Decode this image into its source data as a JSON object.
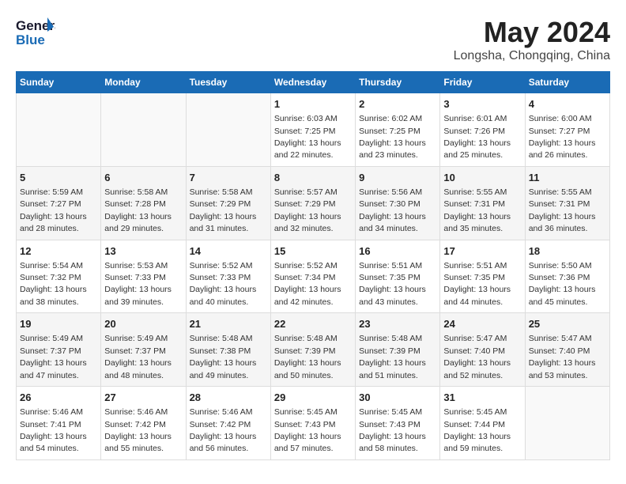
{
  "header": {
    "logo_line1": "General",
    "logo_line2": "Blue",
    "title": "May 2024",
    "subtitle": "Longsha, Chongqing, China"
  },
  "weekdays": [
    "Sunday",
    "Monday",
    "Tuesday",
    "Wednesday",
    "Thursday",
    "Friday",
    "Saturday"
  ],
  "weeks": [
    {
      "days": [
        {
          "num": "",
          "info": ""
        },
        {
          "num": "",
          "info": ""
        },
        {
          "num": "",
          "info": ""
        },
        {
          "num": "1",
          "info": "Sunrise: 6:03 AM\nSunset: 7:25 PM\nDaylight: 13 hours\nand 22 minutes."
        },
        {
          "num": "2",
          "info": "Sunrise: 6:02 AM\nSunset: 7:25 PM\nDaylight: 13 hours\nand 23 minutes."
        },
        {
          "num": "3",
          "info": "Sunrise: 6:01 AM\nSunset: 7:26 PM\nDaylight: 13 hours\nand 25 minutes."
        },
        {
          "num": "4",
          "info": "Sunrise: 6:00 AM\nSunset: 7:27 PM\nDaylight: 13 hours\nand 26 minutes."
        }
      ]
    },
    {
      "days": [
        {
          "num": "5",
          "info": "Sunrise: 5:59 AM\nSunset: 7:27 PM\nDaylight: 13 hours\nand 28 minutes."
        },
        {
          "num": "6",
          "info": "Sunrise: 5:58 AM\nSunset: 7:28 PM\nDaylight: 13 hours\nand 29 minutes."
        },
        {
          "num": "7",
          "info": "Sunrise: 5:58 AM\nSunset: 7:29 PM\nDaylight: 13 hours\nand 31 minutes."
        },
        {
          "num": "8",
          "info": "Sunrise: 5:57 AM\nSunset: 7:29 PM\nDaylight: 13 hours\nand 32 minutes."
        },
        {
          "num": "9",
          "info": "Sunrise: 5:56 AM\nSunset: 7:30 PM\nDaylight: 13 hours\nand 34 minutes."
        },
        {
          "num": "10",
          "info": "Sunrise: 5:55 AM\nSunset: 7:31 PM\nDaylight: 13 hours\nand 35 minutes."
        },
        {
          "num": "11",
          "info": "Sunrise: 5:55 AM\nSunset: 7:31 PM\nDaylight: 13 hours\nand 36 minutes."
        }
      ]
    },
    {
      "days": [
        {
          "num": "12",
          "info": "Sunrise: 5:54 AM\nSunset: 7:32 PM\nDaylight: 13 hours\nand 38 minutes."
        },
        {
          "num": "13",
          "info": "Sunrise: 5:53 AM\nSunset: 7:33 PM\nDaylight: 13 hours\nand 39 minutes."
        },
        {
          "num": "14",
          "info": "Sunrise: 5:52 AM\nSunset: 7:33 PM\nDaylight: 13 hours\nand 40 minutes."
        },
        {
          "num": "15",
          "info": "Sunrise: 5:52 AM\nSunset: 7:34 PM\nDaylight: 13 hours\nand 42 minutes."
        },
        {
          "num": "16",
          "info": "Sunrise: 5:51 AM\nSunset: 7:35 PM\nDaylight: 13 hours\nand 43 minutes."
        },
        {
          "num": "17",
          "info": "Sunrise: 5:51 AM\nSunset: 7:35 PM\nDaylight: 13 hours\nand 44 minutes."
        },
        {
          "num": "18",
          "info": "Sunrise: 5:50 AM\nSunset: 7:36 PM\nDaylight: 13 hours\nand 45 minutes."
        }
      ]
    },
    {
      "days": [
        {
          "num": "19",
          "info": "Sunrise: 5:49 AM\nSunset: 7:37 PM\nDaylight: 13 hours\nand 47 minutes."
        },
        {
          "num": "20",
          "info": "Sunrise: 5:49 AM\nSunset: 7:37 PM\nDaylight: 13 hours\nand 48 minutes."
        },
        {
          "num": "21",
          "info": "Sunrise: 5:48 AM\nSunset: 7:38 PM\nDaylight: 13 hours\nand 49 minutes."
        },
        {
          "num": "22",
          "info": "Sunrise: 5:48 AM\nSunset: 7:39 PM\nDaylight: 13 hours\nand 50 minutes."
        },
        {
          "num": "23",
          "info": "Sunrise: 5:48 AM\nSunset: 7:39 PM\nDaylight: 13 hours\nand 51 minutes."
        },
        {
          "num": "24",
          "info": "Sunrise: 5:47 AM\nSunset: 7:40 PM\nDaylight: 13 hours\nand 52 minutes."
        },
        {
          "num": "25",
          "info": "Sunrise: 5:47 AM\nSunset: 7:40 PM\nDaylight: 13 hours\nand 53 minutes."
        }
      ]
    },
    {
      "days": [
        {
          "num": "26",
          "info": "Sunrise: 5:46 AM\nSunset: 7:41 PM\nDaylight: 13 hours\nand 54 minutes."
        },
        {
          "num": "27",
          "info": "Sunrise: 5:46 AM\nSunset: 7:42 PM\nDaylight: 13 hours\nand 55 minutes."
        },
        {
          "num": "28",
          "info": "Sunrise: 5:46 AM\nSunset: 7:42 PM\nDaylight: 13 hours\nand 56 minutes."
        },
        {
          "num": "29",
          "info": "Sunrise: 5:45 AM\nSunset: 7:43 PM\nDaylight: 13 hours\nand 57 minutes."
        },
        {
          "num": "30",
          "info": "Sunrise: 5:45 AM\nSunset: 7:43 PM\nDaylight: 13 hours\nand 58 minutes."
        },
        {
          "num": "31",
          "info": "Sunrise: 5:45 AM\nSunset: 7:44 PM\nDaylight: 13 hours\nand 59 minutes."
        },
        {
          "num": "",
          "info": ""
        }
      ]
    }
  ]
}
